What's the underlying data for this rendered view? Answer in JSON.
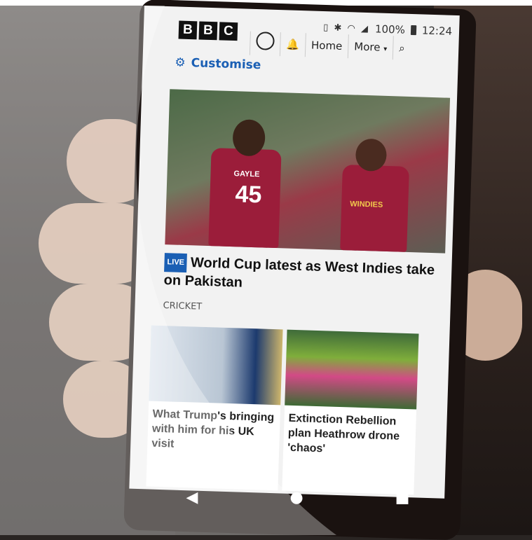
{
  "status_bar": {
    "battery": "100%",
    "time": "12:24",
    "icons": [
      "vibrate-icon",
      "bluetooth-icon",
      "wifi-icon",
      "signal-icon",
      "battery-icon"
    ]
  },
  "header": {
    "logo_letters": [
      "B",
      "B",
      "C"
    ],
    "nav": {
      "home_label": "Home",
      "more_label": "More"
    }
  },
  "customise": {
    "label": "Customise"
  },
  "hero_story": {
    "live_badge": "LIVE",
    "headline": "World Cup latest as West Indies take on Pakistan",
    "category": "CRICKET",
    "player_name": "GAYLE",
    "player_number": "45",
    "sponsor": "WINDIES"
  },
  "stories": [
    {
      "title": "What Trump's bringing with him for his UK visit"
    },
    {
      "title": "Extinction Rebellion plan Heathrow drone 'chaos'"
    }
  ],
  "android_nav": {
    "back": "◀",
    "home": "●",
    "recents": "■"
  },
  "colors": {
    "bbc_blue": "#1a5fb4",
    "jersey_maroon": "#9b1d3a"
  }
}
